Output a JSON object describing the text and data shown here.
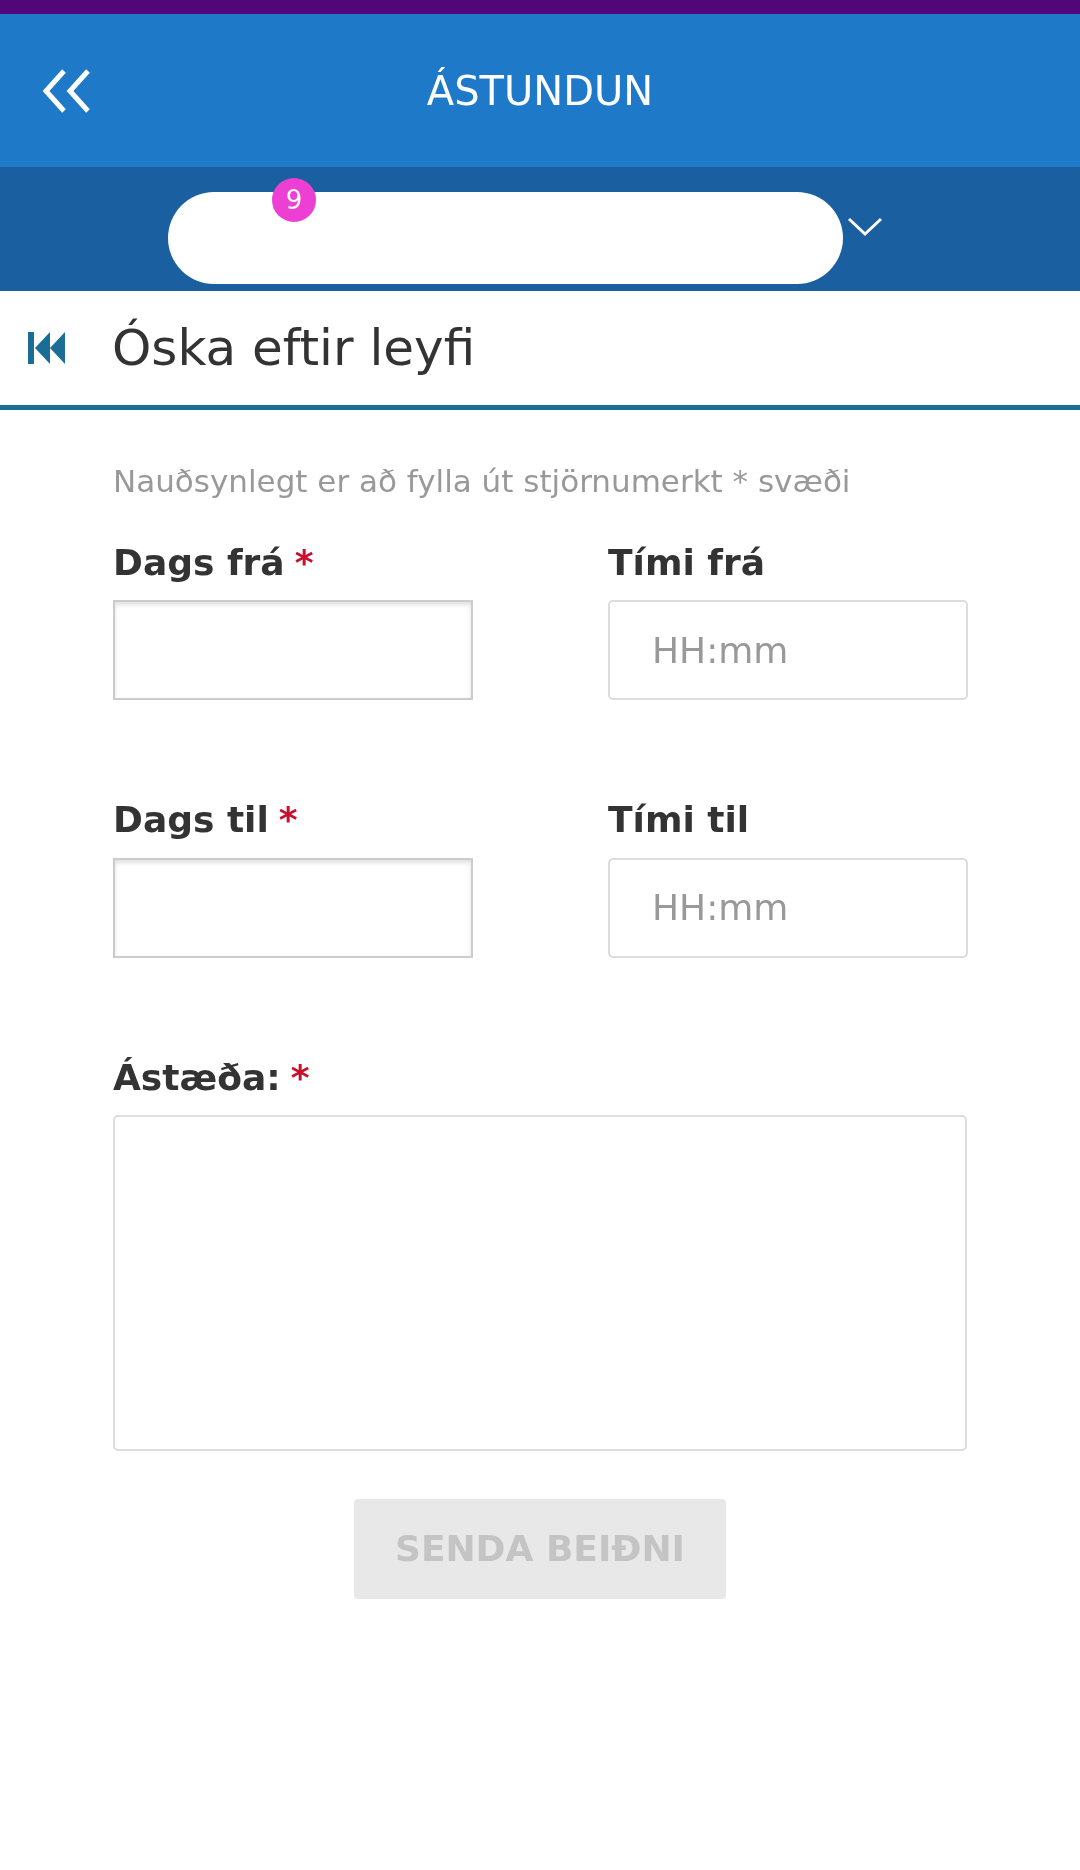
{
  "header": {
    "title": "ÁSTUNDUN"
  },
  "account_bar": {
    "badge": "9"
  },
  "page": {
    "title": "Óska eftir leyfi"
  },
  "form": {
    "hint": "Nauðsynlegt er að fylla út stjörnumerkt * svæði",
    "fields": [
      {
        "kind": "date",
        "label": "Dags frá",
        "required_mark": "*"
      },
      {
        "kind": "time",
        "label": "Tími frá",
        "placeholder": "HH:mm"
      },
      {
        "kind": "date",
        "label": "Dags til",
        "required_mark": "*"
      },
      {
        "kind": "time",
        "label": "Tími til",
        "placeholder": "HH:mm"
      }
    ],
    "reason": {
      "label": "Ástæða:",
      "required_mark": "*"
    },
    "submit": {
      "label": "SENDA BEIÐNI",
      "disabled": true
    }
  }
}
